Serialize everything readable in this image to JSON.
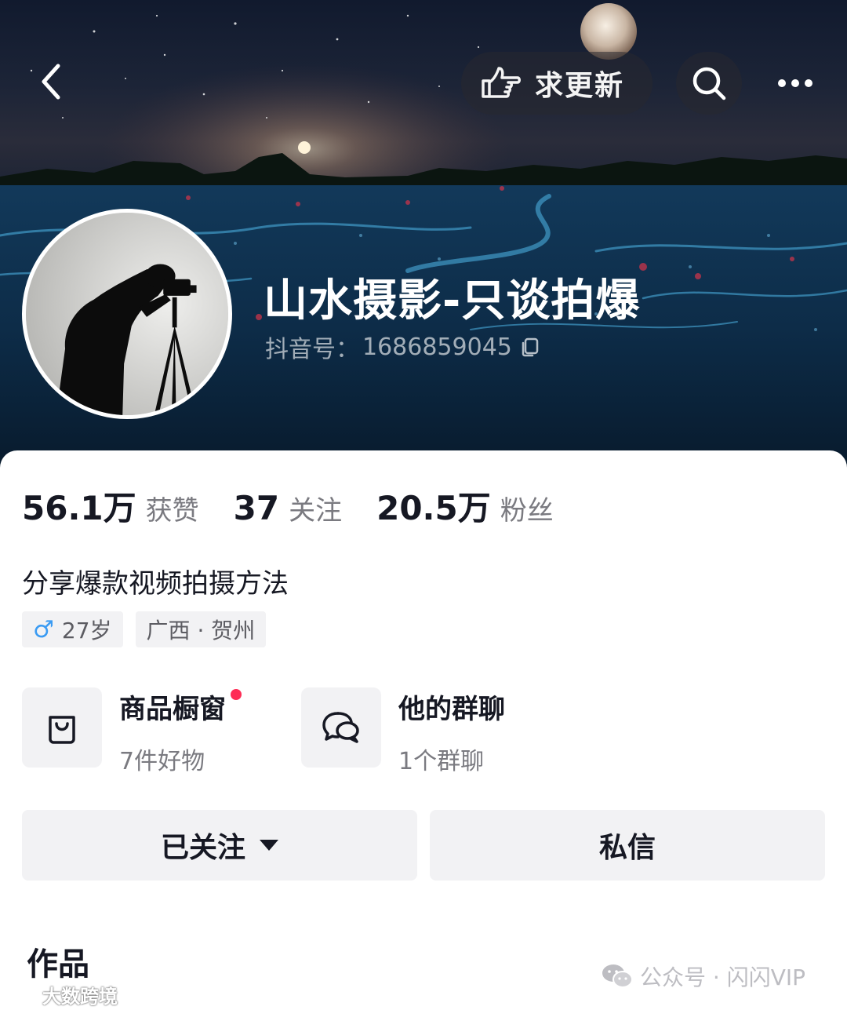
{
  "header": {
    "back_icon": "chevron-left-icon",
    "update_button": {
      "icon": "pointing-hand-icon",
      "label": "求更新"
    },
    "search_icon": "search-icon",
    "more_icon": "more-horizontal-icon"
  },
  "profile": {
    "name": "山水摄影-只谈拍爆",
    "douyin_id_label": "抖音号：",
    "douyin_id": "1686859045",
    "copy_icon": "copy-icon"
  },
  "stats": [
    {
      "value": "56.1万",
      "label": "获赞"
    },
    {
      "value": "37",
      "label": "关注"
    },
    {
      "value": "20.5万",
      "label": "粉丝"
    }
  ],
  "bio": "分享爆款视频拍摄方法",
  "tags": {
    "gender_symbol": "♂",
    "age": "27岁",
    "location": "广西 · 贺州"
  },
  "shortcuts": [
    {
      "icon": "shopping-bag-icon",
      "title": "商品橱窗",
      "subtitle": "7件好物",
      "has_badge": true
    },
    {
      "icon": "group-chat-icon",
      "title": "他的群聊",
      "subtitle": "1个群聊",
      "has_badge": false
    }
  ],
  "actions": {
    "follow_label": "已关注",
    "message_label": "私信"
  },
  "works_title": "作品",
  "watermarks": {
    "right_text": "公众号 · 闪闪VIP",
    "left_text": "大数跨境"
  },
  "colors": {
    "badge_red": "#fe2c55",
    "gender_blue": "#3a9bf3",
    "button_gray": "#f2f2f4"
  }
}
